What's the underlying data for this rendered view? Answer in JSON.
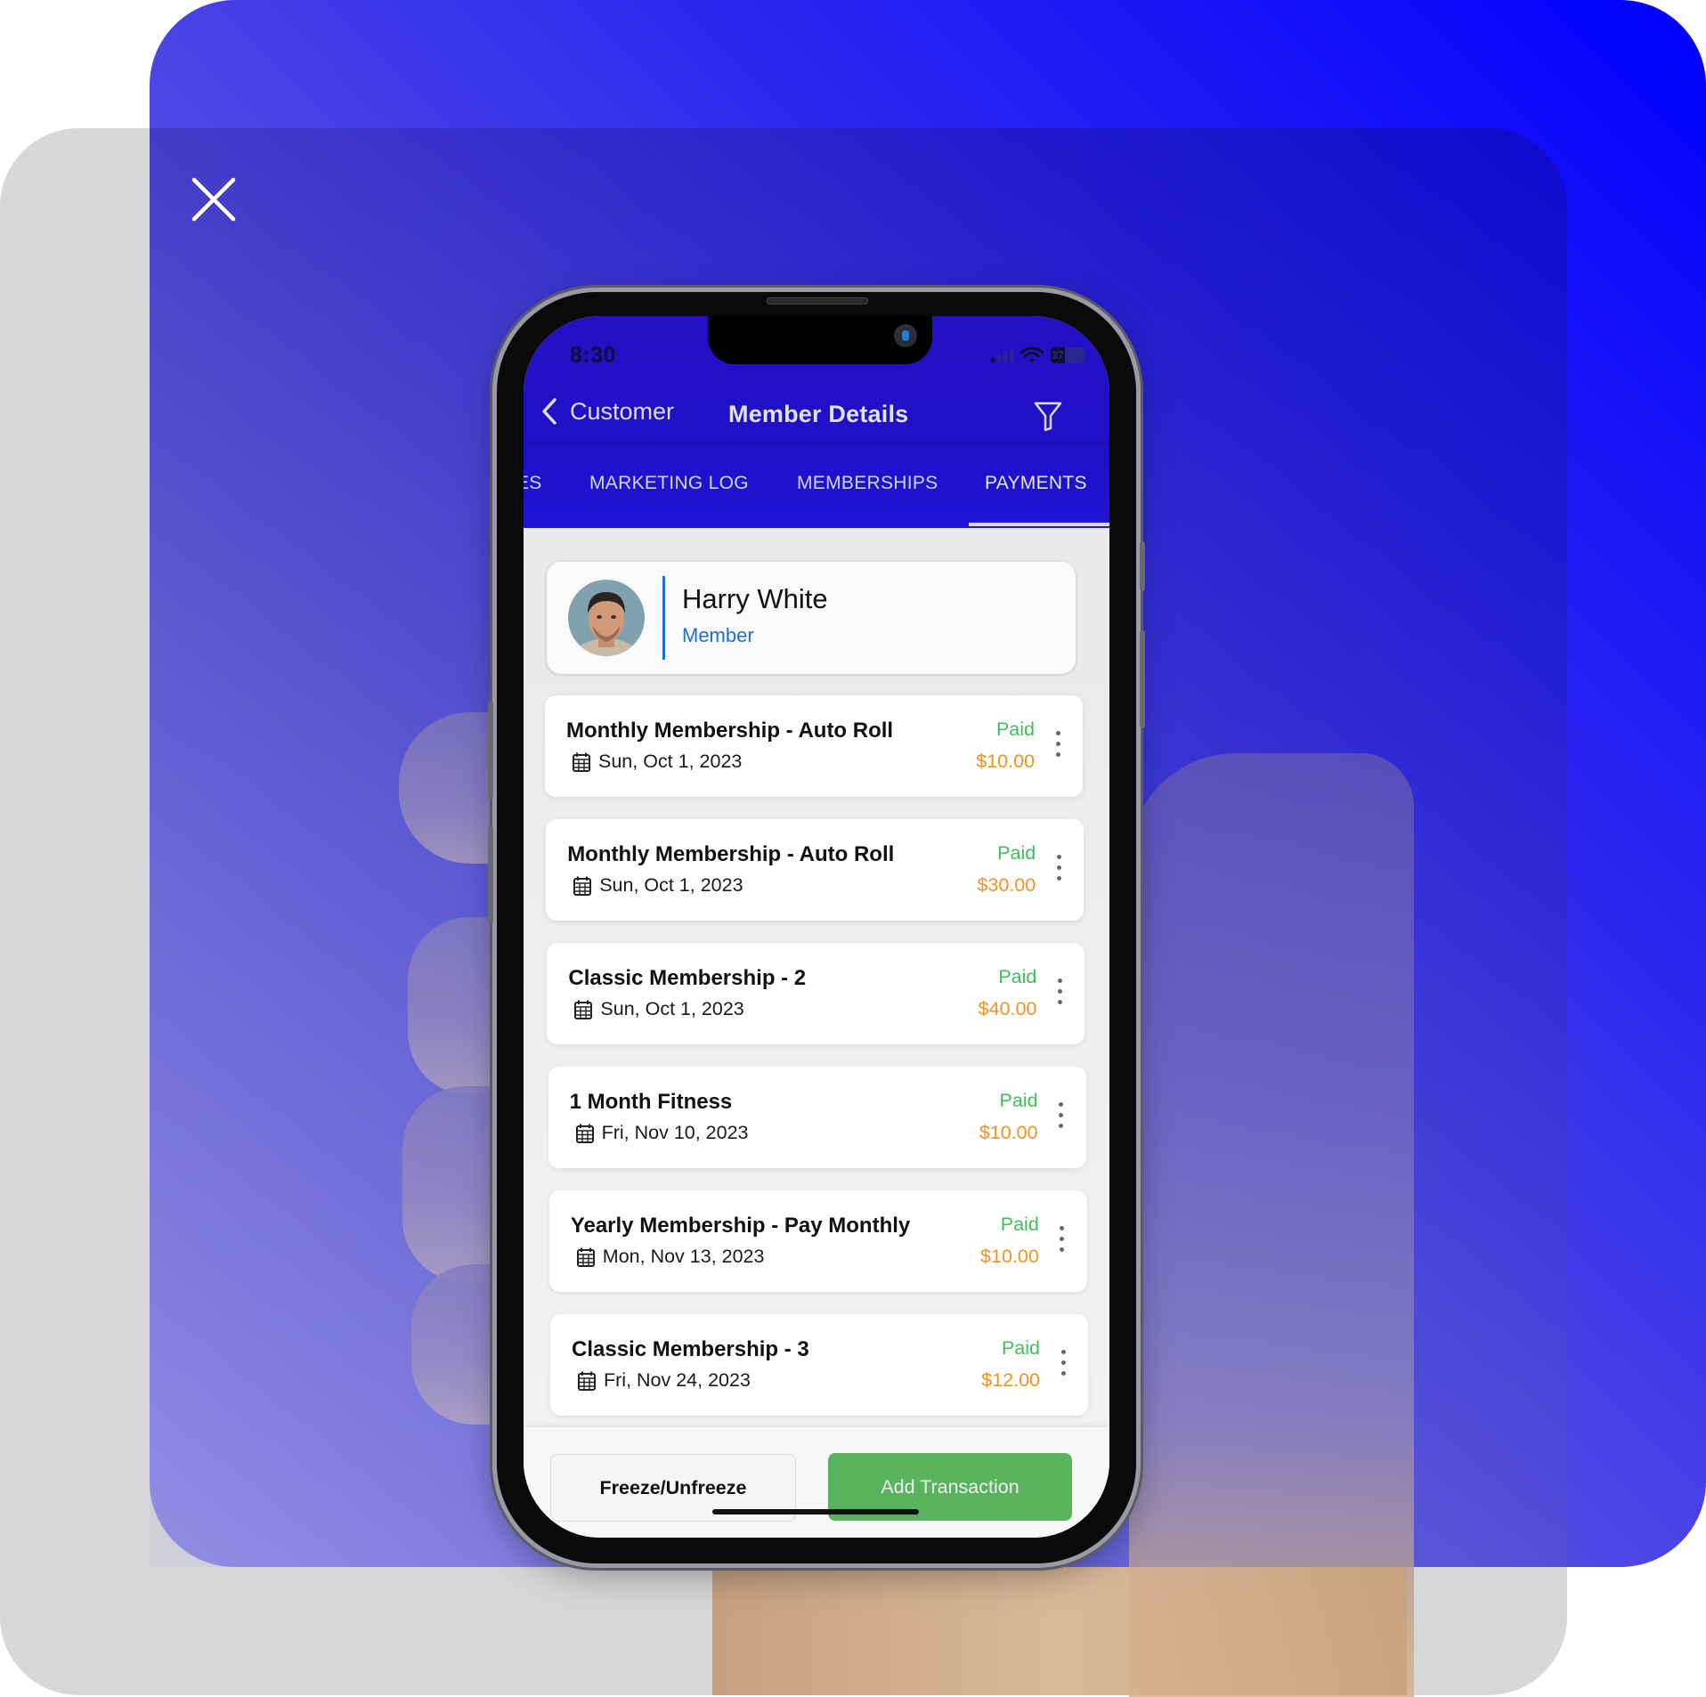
{
  "overlay": {
    "close_icon": "close-icon"
  },
  "status_bar": {
    "time": "8:30",
    "battery_level": "37",
    "icons": [
      "signal-icon",
      "wifi-icon",
      "battery-icon"
    ]
  },
  "header": {
    "back_label": "Customer",
    "title": "Member Details",
    "back_icon": "chevron-left-icon",
    "filter_icon": "filter-icon"
  },
  "tabs": [
    {
      "label": "ES",
      "active": false
    },
    {
      "label": "MARKETING LOG",
      "active": false
    },
    {
      "label": "MEMBERSHIPS",
      "active": false
    },
    {
      "label": "PAYMENTS",
      "active": true
    }
  ],
  "member": {
    "name": "Harry White",
    "role": "Member"
  },
  "payments": [
    {
      "title": "Monthly Membership - Auto Roll",
      "date": "Sun, Oct 1, 2023",
      "status": "Paid",
      "amount": "$10.00"
    },
    {
      "title": "Monthly Membership - Auto Roll",
      "date": "Sun, Oct 1, 2023",
      "status": "Paid",
      "amount": "$30.00"
    },
    {
      "title": "Classic Membership - 2",
      "date": "Sun, Oct 1, 2023",
      "status": "Paid",
      "amount": "$40.00"
    },
    {
      "title": "1 Month Fitness",
      "date": "Fri, Nov 10, 2023",
      "status": "Paid",
      "amount": "$10.00"
    },
    {
      "title": "Yearly Membership - Pay Monthly",
      "date": "Mon, Nov 13, 2023",
      "status": "Paid",
      "amount": "$10.00"
    },
    {
      "title": "Classic Membership - 3",
      "date": "Fri, Nov 24, 2023",
      "status": "Paid",
      "amount": "$12.00"
    }
  ],
  "actions": {
    "freeze_label": "Freeze/Unfreeze",
    "add_label": "Add Transaction"
  },
  "colors": {
    "header_bg": "#2410c4",
    "paid_green": "#3fbf5a",
    "amount_orange": "#f39222",
    "member_blue": "#1f6fcf",
    "add_button_green": "#58b35c",
    "panel_blue": "#0000ff",
    "panel_gray": "#d6d7d9"
  }
}
